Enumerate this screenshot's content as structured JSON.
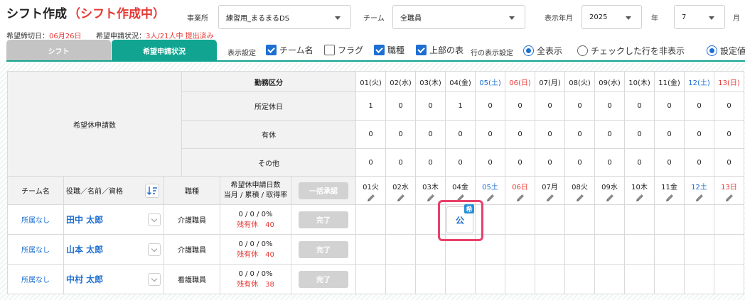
{
  "header": {
    "title": "シフト作成",
    "status": "（シフト作成中）",
    "office_label": "事業所",
    "office_value": "練習用_まるまるDS",
    "team_label": "チーム",
    "team_value": "全職員",
    "period_label": "表示年月",
    "year_value": "2025",
    "year_unit": "年",
    "month_value": "7",
    "month_unit": "月",
    "deadline_label": "希望締切日：",
    "deadline_value": "06月26日",
    "apply_label": "希望申請状況：",
    "apply_value": "3人/21人中 提出済み"
  },
  "tabs": [
    {
      "label": "シフト"
    },
    {
      "label": "希望申請状況"
    }
  ],
  "display_settings": {
    "label": "表示設定",
    "options": [
      {
        "label": "チーム名",
        "checked": true
      },
      {
        "label": "フラグ",
        "checked": false
      },
      {
        "label": "職種",
        "checked": true
      },
      {
        "label": "上部の表",
        "checked": true
      }
    ],
    "row_label": "行の表示設定",
    "row_options": [
      {
        "label": "全表示",
        "selected": true
      },
      {
        "label": "チェックした行を非表示",
        "selected": false
      },
      {
        "label": "設定値",
        "selected": true
      }
    ]
  },
  "summary": {
    "left_label": "希望休申請数",
    "col_header": "勤務区分",
    "days": [
      {
        "label": "01(火)",
        "type": "normal"
      },
      {
        "label": "02(水)",
        "type": "normal"
      },
      {
        "label": "03(木)",
        "type": "normal"
      },
      {
        "label": "04(金)",
        "type": "normal"
      },
      {
        "label": "05(土)",
        "type": "sat"
      },
      {
        "label": "06(日)",
        "type": "sun"
      },
      {
        "label": "07(月)",
        "type": "normal"
      },
      {
        "label": "08(火)",
        "type": "normal"
      },
      {
        "label": "09(水)",
        "type": "normal"
      },
      {
        "label": "10(木)",
        "type": "normal"
      },
      {
        "label": "11(金)",
        "type": "normal"
      },
      {
        "label": "12(土)",
        "type": "sat"
      },
      {
        "label": "13(日)",
        "type": "sun"
      }
    ],
    "rows": [
      {
        "label": "所定休日",
        "values": [
          "1",
          "0",
          "0",
          "1",
          "0",
          "0",
          "0",
          "0",
          "0",
          "0",
          "0",
          "0",
          "0"
        ]
      },
      {
        "label": "有休",
        "values": [
          "0",
          "0",
          "0",
          "0",
          "0",
          "0",
          "0",
          "0",
          "0",
          "0",
          "0",
          "0",
          "0"
        ]
      },
      {
        "label": "その他",
        "values": [
          "0",
          "0",
          "0",
          "0",
          "0",
          "0",
          "0",
          "0",
          "0",
          "0",
          "0",
          "0",
          "0"
        ]
      }
    ]
  },
  "staff_table": {
    "headers": {
      "team": "チーム名",
      "name": "役職／名前／資格",
      "job": "職種",
      "days_line1": "希望休申請日数",
      "days_line2": "当月 / 累積 / 取得率",
      "bulk_button": "一括承認"
    },
    "days": [
      {
        "label": "01火",
        "type": "normal"
      },
      {
        "label": "02水",
        "type": "normal"
      },
      {
        "label": "03木",
        "type": "normal"
      },
      {
        "label": "04金",
        "type": "normal"
      },
      {
        "label": "05土",
        "type": "sat"
      },
      {
        "label": "06日",
        "type": "sun"
      },
      {
        "label": "07月",
        "type": "normal"
      },
      {
        "label": "08火",
        "type": "normal"
      },
      {
        "label": "09水",
        "type": "normal"
      },
      {
        "label": "10木",
        "type": "normal"
      },
      {
        "label": "11金",
        "type": "normal"
      },
      {
        "label": "12土",
        "type": "sat"
      },
      {
        "label": "13日",
        "type": "sun"
      }
    ],
    "rows": [
      {
        "team": "所属なし",
        "name": "田中 太郎",
        "job": "介護職員",
        "stats": "0 / 0 / 0%",
        "remain": "残有休　40",
        "button": "完了"
      },
      {
        "team": "所属なし",
        "name": "山本 太郎",
        "job": "介護職員",
        "stats": "0 / 0 / 0%",
        "remain": "残有休　40",
        "button": "完了"
      },
      {
        "team": "所属なし",
        "name": "中村 太郎",
        "job": "看護職員",
        "stats": "0 / 0 / 0%",
        "remain": "残有休　38",
        "button": "完了"
      }
    ],
    "highlight": {
      "chip": "公",
      "badge": "希"
    }
  },
  "colors": {
    "accent": "#11a591",
    "link": "#1e6fd0",
    "alert": "#e53935",
    "highlight": "#e8406a"
  }
}
